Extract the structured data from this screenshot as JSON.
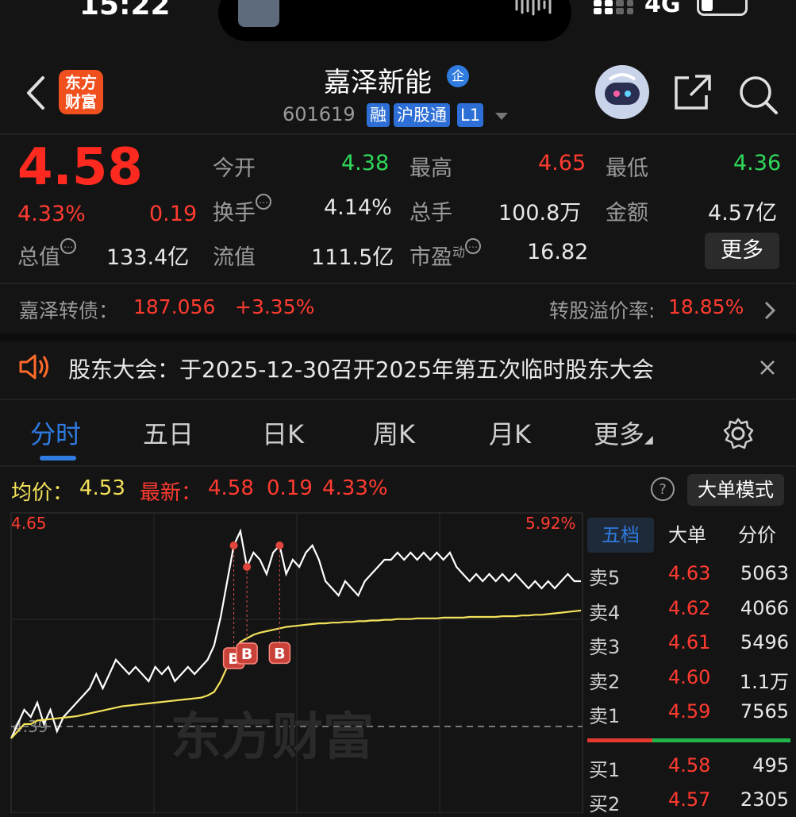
{
  "status_bar": {
    "time": "15:22",
    "network": "4G"
  },
  "header": {
    "logo_text_line1": "东方",
    "logo_text_line2": "财富",
    "stock_name": "嘉泽新能",
    "qi_badge": "企",
    "stock_code": "601619",
    "tags": [
      "融",
      "沪股通",
      "L1"
    ]
  },
  "quote": {
    "price": "4.58",
    "change_pct": "4.33%",
    "change": "0.19",
    "open_label": "今开",
    "open": "4.38",
    "high_label": "最高",
    "high": "4.65",
    "low_label": "最低",
    "low": "4.36",
    "turnover_label": "换手",
    "turnover": "4.14%",
    "volume_label": "总手",
    "volume": "100.8万",
    "amount_label": "金额",
    "amount": "4.57亿",
    "mktcap_label": "总值",
    "mktcap": "133.4亿",
    "float_label": "流值",
    "float_cap": "111.5亿",
    "pe_label": "市盈",
    "pe_sup": "动",
    "pe": "16.82",
    "more_label": "更多"
  },
  "bond": {
    "label": "嘉泽转债：",
    "price": "187.056",
    "change": "+3.35%",
    "premium_label": "转股溢价率:",
    "premium": "18.85%"
  },
  "notice": {
    "text": "股东大会：于2025-12-30召开2025年第五次临时股东大会"
  },
  "tabs": [
    "分时",
    "五日",
    "日K",
    "周K",
    "月K",
    "更多"
  ],
  "chart_header": {
    "avg_label": "均价：",
    "avg": "4.53",
    "latest_label": "最新：",
    "latest": "4.58",
    "latest_change": "0.19",
    "latest_pct": "4.33%",
    "help": "?",
    "big_order_mode": "大单模式"
  },
  "chart_data": {
    "type": "line",
    "title": "",
    "y_top_label": "4.65",
    "y_top_pct": "5.92%",
    "y_base_label": "4.39",
    "ylim": [
      4.36,
      4.66
    ],
    "watermark": "东方财富",
    "series": [
      {
        "name": "",
        "color": "#ffffff",
        "values": [
          4.36,
          4.38,
          4.4,
          4.39,
          4.41,
          4.38,
          4.4,
          4.37,
          4.39,
          4.4,
          4.41,
          4.42,
          4.43,
          4.45,
          4.43,
          4.45,
          4.47,
          4.46,
          4.45,
          4.46,
          4.45,
          4.44,
          4.46,
          4.45,
          4.46,
          4.44,
          4.45,
          4.46,
          4.45,
          4.46,
          4.47,
          4.49,
          4.53,
          4.58,
          4.63,
          4.65,
          4.6,
          4.62,
          4.61,
          4.59,
          4.62,
          4.63,
          4.59,
          4.61,
          4.6,
          4.62,
          4.63,
          4.61,
          4.58,
          4.57,
          4.56,
          4.58,
          4.57,
          4.56,
          4.58,
          4.59,
          4.6,
          4.61,
          4.61,
          4.62,
          4.61,
          4.62,
          4.61,
          4.62,
          4.61,
          4.62,
          4.61,
          4.62,
          4.6,
          4.59,
          4.58,
          4.59,
          4.58,
          4.59,
          4.58,
          4.59,
          4.58,
          4.59,
          4.58,
          4.57,
          4.58,
          4.57,
          4.58,
          4.57,
          4.58,
          4.59,
          4.58,
          4.58
        ]
      },
      {
        "name": "",
        "color": "#f2e15a",
        "values": [
          4.36,
          4.37,
          4.38,
          4.38,
          4.385,
          4.386,
          4.387,
          4.388,
          4.389,
          4.39,
          4.391,
          4.393,
          4.395,
          4.397,
          4.399,
          4.401,
          4.403,
          4.405,
          4.406,
          4.407,
          4.408,
          4.409,
          4.41,
          4.411,
          4.412,
          4.413,
          4.414,
          4.415,
          4.416,
          4.417,
          4.42,
          4.425,
          4.44,
          4.46,
          4.48,
          4.495,
          4.5,
          4.505,
          4.508,
          4.51,
          4.512,
          4.514,
          4.516,
          4.517,
          4.518,
          4.519,
          4.52,
          4.521,
          4.521,
          4.522,
          4.522,
          4.523,
          4.523,
          4.524,
          4.524,
          4.525,
          4.525,
          4.526,
          4.526,
          4.527,
          4.527,
          4.527,
          4.528,
          4.528,
          4.528,
          4.528,
          4.529,
          4.529,
          4.529,
          4.529,
          4.53,
          4.53,
          4.53,
          4.53,
          4.53,
          4.531,
          4.531,
          4.531,
          4.532,
          4.532,
          4.533,
          4.533,
          4.534,
          4.535,
          4.536,
          4.537,
          4.538,
          4.539
        ]
      }
    ],
    "buy_markers": [
      {
        "index": 34,
        "label": "B"
      },
      {
        "index": 36,
        "label": "B"
      },
      {
        "index": 41,
        "label": "B"
      }
    ]
  },
  "order_book": {
    "tabs": [
      "五档",
      "大单",
      "分价"
    ],
    "asks": [
      {
        "label": "卖5",
        "price": "4.63",
        "vol": "5063"
      },
      {
        "label": "卖4",
        "price": "4.62",
        "vol": "4066"
      },
      {
        "label": "卖3",
        "price": "4.61",
        "vol": "5496"
      },
      {
        "label": "卖2",
        "price": "4.60",
        "vol": "1.1万"
      },
      {
        "label": "卖1",
        "price": "4.59",
        "vol": "7565"
      }
    ],
    "bids": [
      {
        "label": "买1",
        "price": "4.58",
        "vol": "495"
      },
      {
        "label": "买2",
        "price": "4.57",
        "vol": "2305"
      }
    ]
  }
}
